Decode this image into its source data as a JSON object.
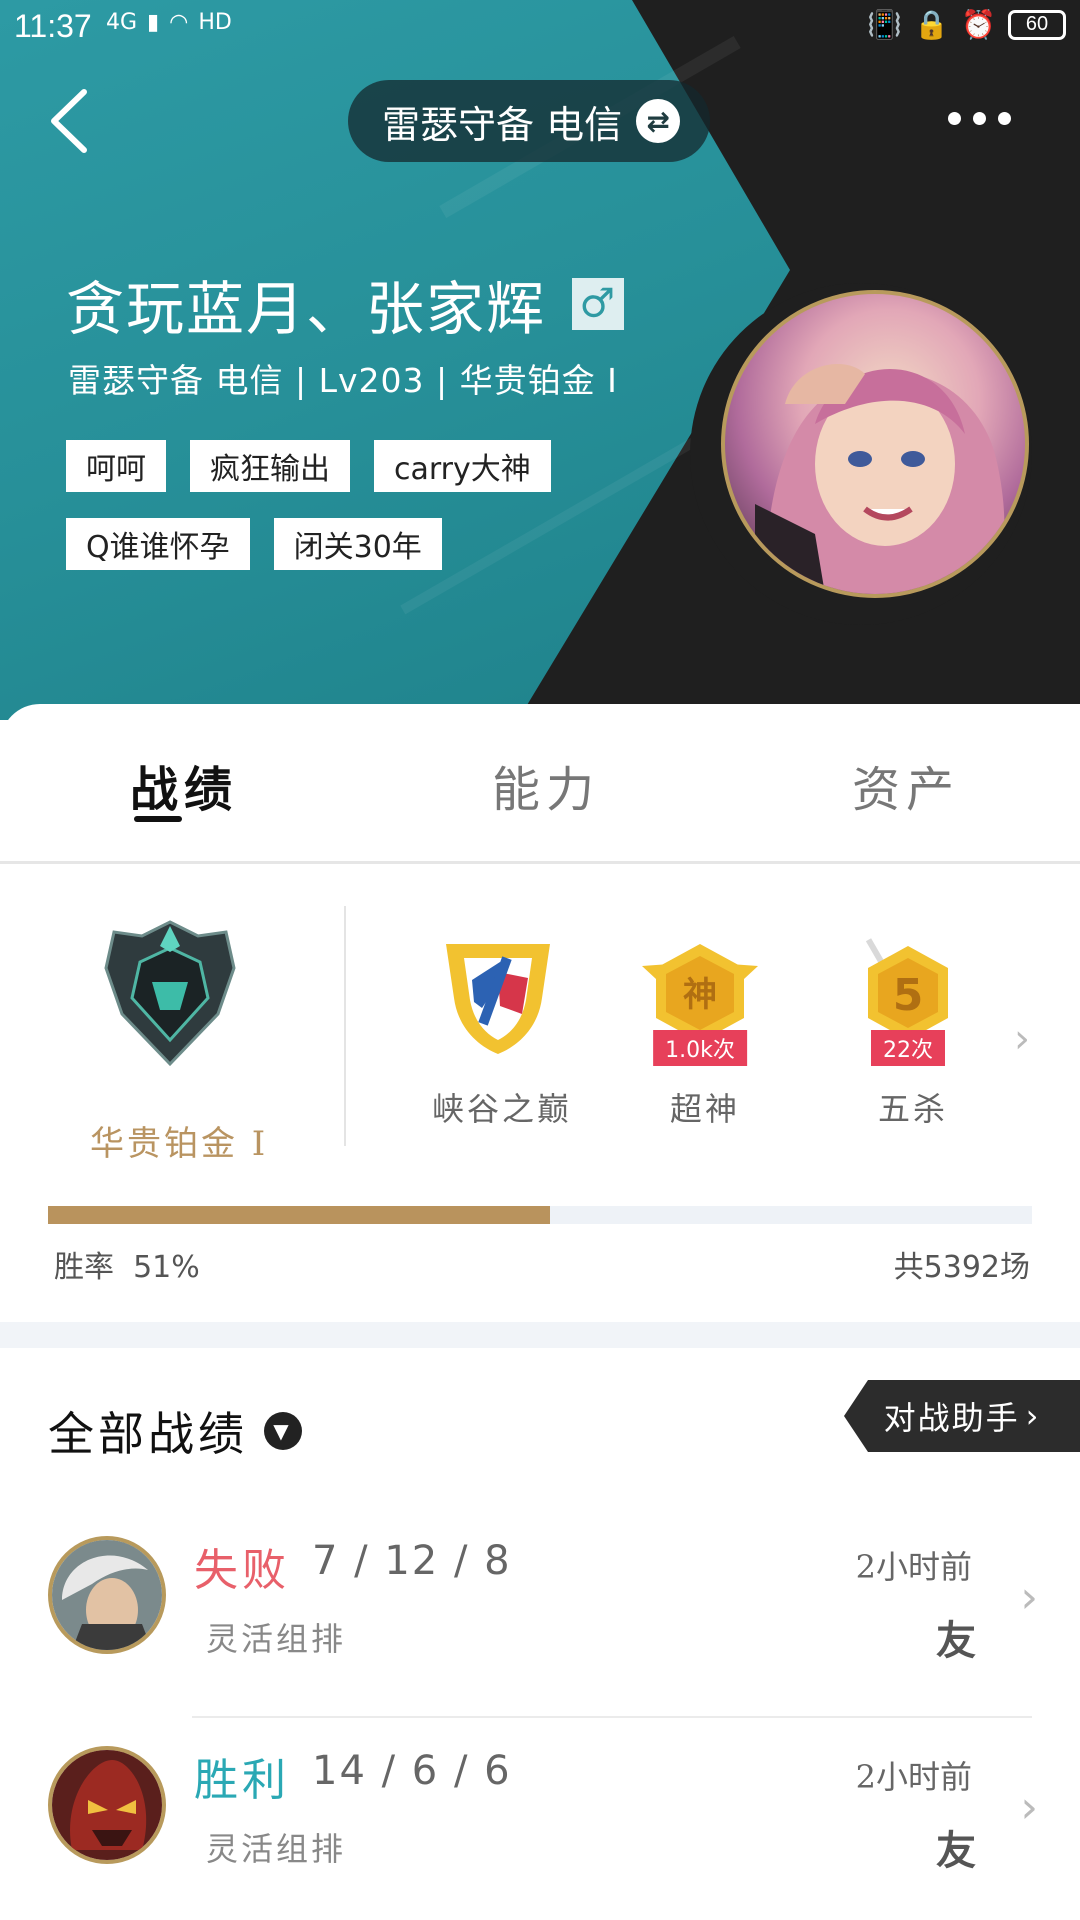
{
  "status_bar": {
    "time": "11:37",
    "network": "4G",
    "hd": "HD",
    "battery": "60"
  },
  "header": {
    "server": "雷瑟守备 电信",
    "player_name": "贪玩蓝月、张家辉",
    "gender_symbol": "♂",
    "meta": "雷瑟守备 电信 | Lv203 | 华贵铂金 I",
    "tags": [
      "呵呵",
      "疯狂输出",
      "carry大神",
      "Q谁谁怀孕",
      "闭关30年"
    ]
  },
  "tabs": [
    {
      "label": "战绩",
      "active": true
    },
    {
      "label": "能力",
      "active": false
    },
    {
      "label": "资产",
      "active": false
    }
  ],
  "rank": {
    "label": "华贵铂金 I",
    "badges": [
      {
        "label": "峡谷之巅",
        "count": "",
        "icon": "summit-badge-icon"
      },
      {
        "label": "超神",
        "count": "1.0k次",
        "icon": "legendary-badge-icon"
      },
      {
        "label": "五杀",
        "count": "22次",
        "icon": "pentakill-badge-icon"
      }
    ],
    "win_rate_label": "胜率",
    "win_rate": "51%",
    "win_rate_fraction": 0.51,
    "total_games": "共5392场"
  },
  "matches_section": {
    "title": "全部战绩",
    "assistant_button": "对战助手"
  },
  "matches": [
    {
      "result": "失败",
      "result_color": "#e8606a",
      "kda": "7 / 12 / 8",
      "mode": "灵活组排",
      "time": "2小时前",
      "friend": "友"
    },
    {
      "result": "胜利",
      "result_color": "#2aa8b4",
      "kda": "14 / 6 / 6",
      "mode": "灵活组排",
      "time": "2小时前",
      "friend": "友"
    }
  ],
  "colors": {
    "teal": "#2d9aa4",
    "dark": "#1f1f1f",
    "gold": "#b9935d"
  }
}
